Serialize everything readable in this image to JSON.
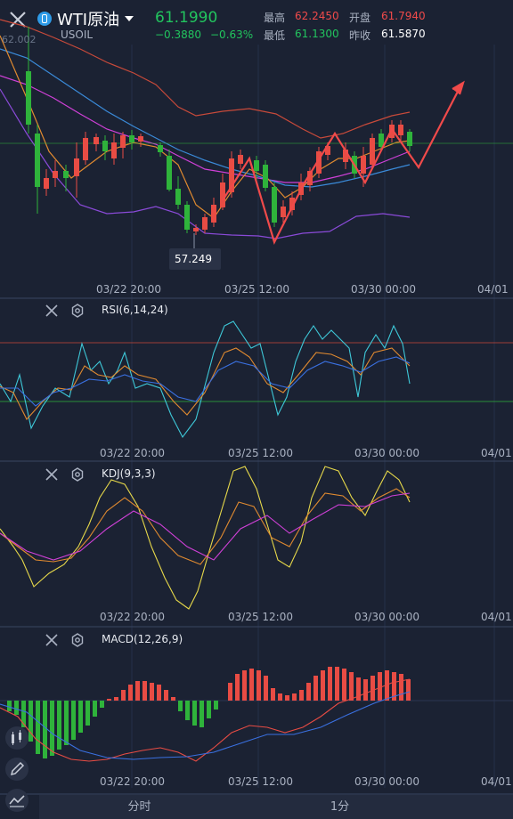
{
  "header": {
    "symbol": "WTI原油",
    "code": "USOIL",
    "price": "61.1990",
    "change": "−0.3880",
    "change_pct": "−0.63%",
    "high_label": "最高",
    "high_value": "62.2450",
    "low_label": "最低",
    "low_value": "61.1300",
    "open_label": "开盘",
    "open_value": "61.7940",
    "prev_close_label": "昨收",
    "prev_close_value": "61.5870",
    "partial_label": "62.002"
  },
  "main_chart": {
    "min_label": "57.249",
    "x_ticks": [
      "03/22 20:00",
      "03/25 12:00",
      "03/30 00:00",
      "04/01"
    ]
  },
  "rsi": {
    "title": "RSI(6,14,24)",
    "x_ticks": [
      "03/22 20:00",
      "03/25 12:00",
      "03/30 00:00",
      "04/01"
    ]
  },
  "kdj": {
    "title": "KDJ(9,3,3)",
    "x_ticks": [
      "03/22 20:00",
      "03/25 12:00",
      "03/30 00:00",
      "04/01"
    ]
  },
  "macd": {
    "title": "MACD(12,26,9)",
    "x_ticks": [
      "03/22 20:00",
      "03/25 12:00",
      "03/30 00:00",
      "04/01"
    ]
  },
  "bottom_tabs": [
    "分时",
    "1分"
  ],
  "colors": {
    "up": "#e84c44",
    "down": "#2fb33b",
    "up_text": "#22c45e",
    "accent_red": "#f04a4a",
    "bg": "#1b2233"
  },
  "icons": {
    "close": "close-icon",
    "settings": "gear-icon",
    "candles_tool": "candlestick-tool-icon",
    "pen_tool": "pen-icon",
    "indicator_tool": "indicator-icon"
  }
}
